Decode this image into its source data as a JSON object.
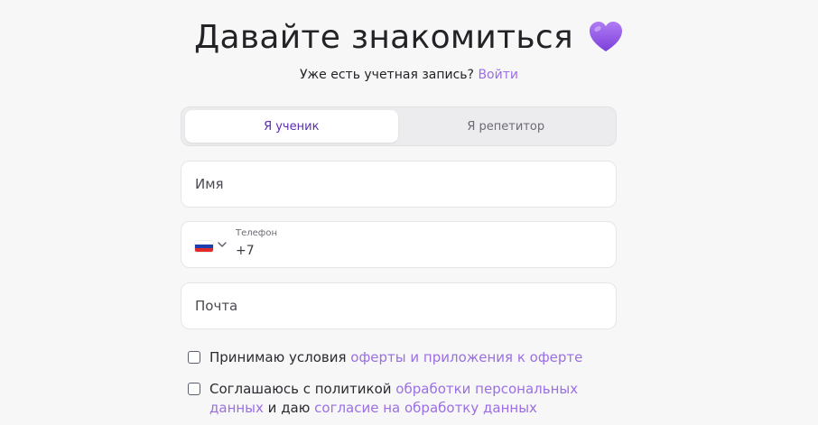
{
  "header": {
    "title": "Давайте знакомиться",
    "heart_icon": "purple-heart-icon"
  },
  "login": {
    "prompt": "Уже есть учетная запись?",
    "link": "Войти"
  },
  "tabs": [
    {
      "label": "Я ученик",
      "active": true
    },
    {
      "label": "Я репетитор",
      "active": false
    }
  ],
  "form": {
    "name_placeholder": "Имя",
    "phone": {
      "label": "Телефон",
      "value": "+7",
      "country_icon": "russia-flag-icon"
    },
    "email_placeholder": "Почта"
  },
  "agreements": {
    "offer": {
      "text": "Принимаю условия ",
      "link": "оферты и приложения к оферте"
    },
    "privacy": {
      "text": "Соглашаюсь с политикой ",
      "link1": "обработки персональных данных",
      "mid": " и даю ",
      "link2": "согласие на обработку данных"
    }
  },
  "colors": {
    "accent": "#9b6fe3",
    "active_tab_text": "#5b2fb0",
    "background": "#f7f7f8"
  }
}
